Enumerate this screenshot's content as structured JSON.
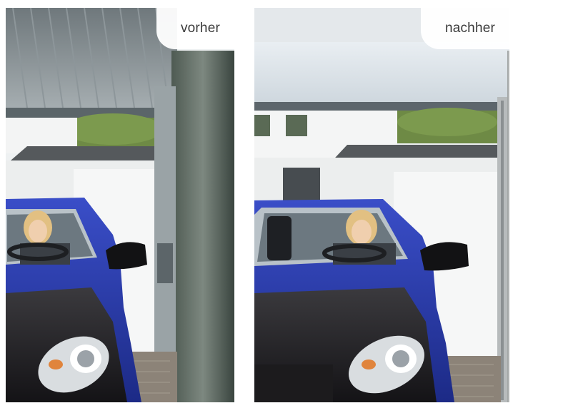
{
  "panels": [
    {
      "id": "before",
      "label": "vorher"
    },
    {
      "id": "after",
      "label": "nachher"
    }
  ]
}
